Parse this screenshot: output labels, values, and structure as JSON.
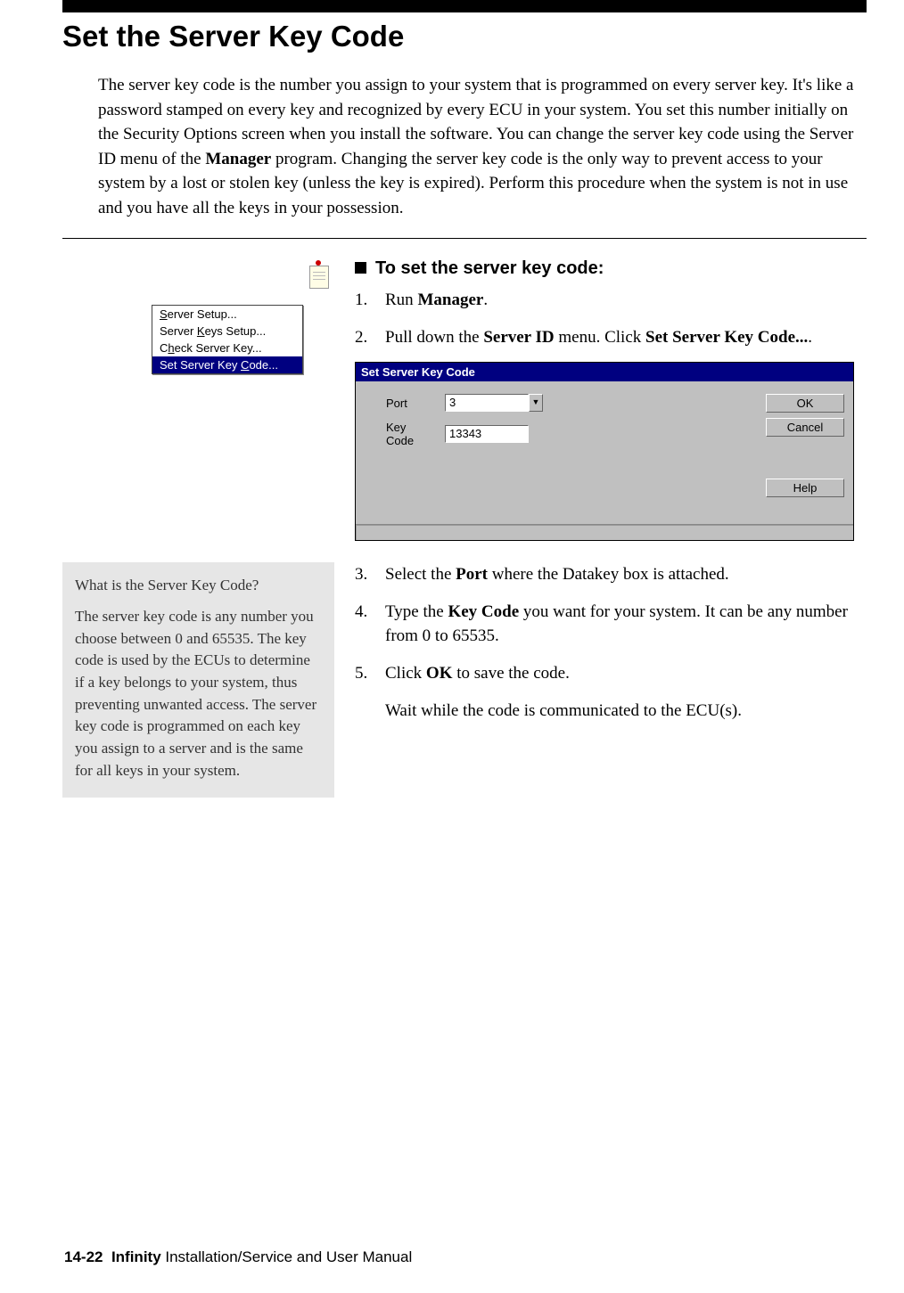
{
  "page": {
    "title": "Set the Server Key Code",
    "intro_html": "The server key code is the number you assign to your system that is programmed on every server key. It's like a password stamped on every key and recognized by every ECU in your system. You set this number initially on the Security Options screen when you install the software. You can change the server key code using the Server ID menu of the <b>Manager</b> program. Changing the server key code is the only way to prevent access to your system by a lost or stolen key (unless the key is expired). Perform this procedure when the system is not in use and you have all the keys in your possession."
  },
  "procedure": {
    "heading": "To set the server key code:",
    "steps": [
      {
        "html": "Run <b>Manager</b>."
      },
      {
        "html": "Pull down the <b>Server ID</b> menu. Click <b>Set Server Key Code...</b>."
      },
      {
        "html": "Select the <b>Port</b> where the Datakey box is attached."
      },
      {
        "html": "Type the <b>Key Code</b> you want for your system. It can be any number from 0 to 65535."
      },
      {
        "html": "Click <b>OK</b> to save the code."
      }
    ],
    "trailing": "Wait while the code is communicated to the ECU(s)."
  },
  "menu": {
    "items": [
      {
        "pre": "",
        "u": "S",
        "post": "erver Setup...",
        "sel": false
      },
      {
        "pre": "Server ",
        "u": "K",
        "post": "eys Setup...",
        "sel": false
      },
      {
        "pre": "C",
        "u": "h",
        "post": "eck Server Key...",
        "sel": false
      },
      {
        "pre": "Set Server Key ",
        "u": "C",
        "post": "ode...",
        "sel": true
      }
    ]
  },
  "dialog": {
    "title": "Set Server Key Code",
    "port_label": "Port",
    "port_value": "3",
    "keycode_label": "Key Code",
    "keycode_value": "13343",
    "ok": "OK",
    "cancel": "Cancel",
    "help": "Help"
  },
  "sidenote": {
    "title": "What is the Server Key Code?",
    "body": "The server key code is any number you choose between 0 and 65535. The key code is used by the ECUs to determine if a key belongs to your system, thus preventing unwanted access. The server key code is programmed on each key you assign to a server and is the same for all keys in your system."
  },
  "footer": {
    "pagenum": "14-22",
    "book": "Infinity",
    "tail": " Installation/Service and User Manual"
  }
}
